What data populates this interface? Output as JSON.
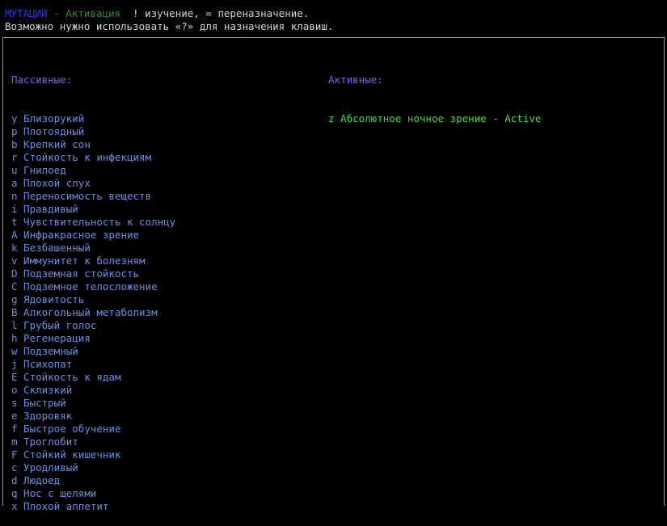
{
  "header": {
    "title": "МУТАЦИИ",
    "separator": " - ",
    "mode": "Активация",
    "hint_study": "  ! изучение, = переназначение.",
    "hint_keys": "Возможно нужно использовать «?» для назначения клавиш."
  },
  "passive": {
    "label": "Пассивные:",
    "items": [
      {
        "key": "y",
        "name": "Близорукий"
      },
      {
        "key": "p",
        "name": "Плотоядный"
      },
      {
        "key": "b",
        "name": "Крепкий сон"
      },
      {
        "key": "r",
        "name": "Стойкость к инфекциям"
      },
      {
        "key": "u",
        "name": "Гнилоед"
      },
      {
        "key": "a",
        "name": "Плохой слух"
      },
      {
        "key": "n",
        "name": "Переносимость веществ"
      },
      {
        "key": "i",
        "name": "Правдивый"
      },
      {
        "key": "t",
        "name": "Чувствительность к солнцу"
      },
      {
        "key": "A",
        "name": "Инфракрасное зрение"
      },
      {
        "key": "k",
        "name": "Безбашенный"
      },
      {
        "key": "v",
        "name": "Иммунитет к болезням"
      },
      {
        "key": "D",
        "name": "Подземная стойкость"
      },
      {
        "key": "C",
        "name": "Подземное телосложение"
      },
      {
        "key": "g",
        "name": "Ядовитость"
      },
      {
        "key": "B",
        "name": "Алкогольный метаболизм"
      },
      {
        "key": "l",
        "name": "Грубый голос"
      },
      {
        "key": "h",
        "name": "Регенерация"
      },
      {
        "key": "w",
        "name": "Подземный"
      },
      {
        "key": "j",
        "name": "Психопат"
      },
      {
        "key": "E",
        "name": "Стойкость к ядам"
      },
      {
        "key": "o",
        "name": "Склизкий"
      },
      {
        "key": "s",
        "name": "Быстрый"
      },
      {
        "key": "e",
        "name": "Здоровяк"
      },
      {
        "key": "f",
        "name": "Быстрое обучение"
      },
      {
        "key": "m",
        "name": "Троглобит"
      },
      {
        "key": "F",
        "name": "Стойкий кишечник"
      },
      {
        "key": "c",
        "name": "Уродливый"
      },
      {
        "key": "d",
        "name": "Людоед"
      },
      {
        "key": "q",
        "name": "Нос с щелями"
      },
      {
        "key": "x",
        "name": "Плохой аппетит"
      }
    ]
  },
  "active": {
    "label": "Активные:",
    "items": [
      {
        "key": "z",
        "name": "Абсолютное ночное зрение",
        "state": "Active"
      }
    ]
  }
}
